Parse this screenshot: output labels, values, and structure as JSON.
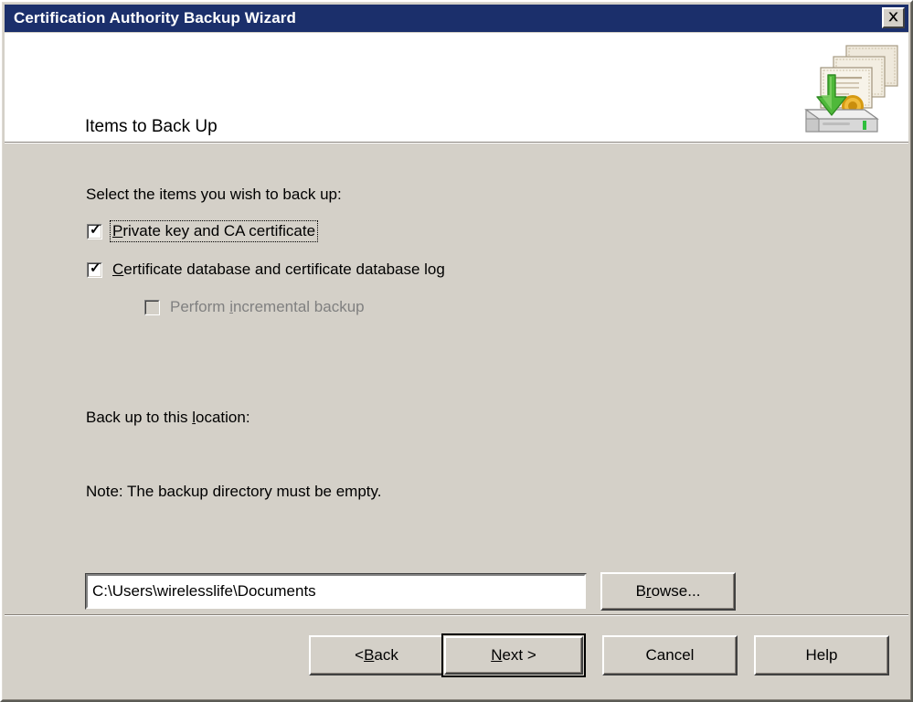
{
  "window": {
    "title": "Certification Authority Backup Wizard",
    "close_label": "×",
    "close_icon": "close-icon",
    "titlebar_color": "#1b2f6b",
    "face_color": "#d4d0c8"
  },
  "header": {
    "title": "Items to Back Up",
    "icon": "certificate-backup-icon"
  },
  "body": {
    "instruction": "Select the items you wish to back up:",
    "checkboxes": [
      {
        "name": "private-key-and-ca-certificate",
        "label_prefix": "",
        "accelerator": "P",
        "label_suffix": "rivate key and CA certificate",
        "checked": true,
        "enabled": true,
        "focused": true
      },
      {
        "name": "certificate-database-and-log",
        "label_prefix": "",
        "accelerator": "C",
        "label_suffix": "ertificate database and certificate database log",
        "checked": true,
        "enabled": true,
        "focused": false
      },
      {
        "name": "perform-incremental-backup",
        "label_prefix": "Perform ",
        "accelerator": "i",
        "label_suffix": "ncremental backup",
        "checked": false,
        "enabled": false,
        "focused": false
      }
    ],
    "location_label_prefix": "Back up to this ",
    "location_label_accelerator": "l",
    "location_label_suffix": "ocation:",
    "location_value": "C:\\Users\\wirelesslife\\Documents",
    "location_placeholder": "",
    "note": "Note: The backup directory must be empty.",
    "browse_button": {
      "prefix": "B",
      "accelerator": "r",
      "suffix": "owse..."
    }
  },
  "footer": {
    "buttons": [
      {
        "name": "back-button",
        "prefix": "< ",
        "accelerator": "B",
        "suffix": "ack",
        "default": false
      },
      {
        "name": "next-button",
        "prefix": "",
        "accelerator": "N",
        "suffix": "ext >",
        "default": true
      },
      {
        "name": "cancel-button",
        "prefix": "Cancel",
        "accelerator": "",
        "suffix": "",
        "default": false
      },
      {
        "name": "help-button",
        "prefix": "Help",
        "accelerator": "",
        "suffix": "",
        "default": false
      }
    ]
  }
}
